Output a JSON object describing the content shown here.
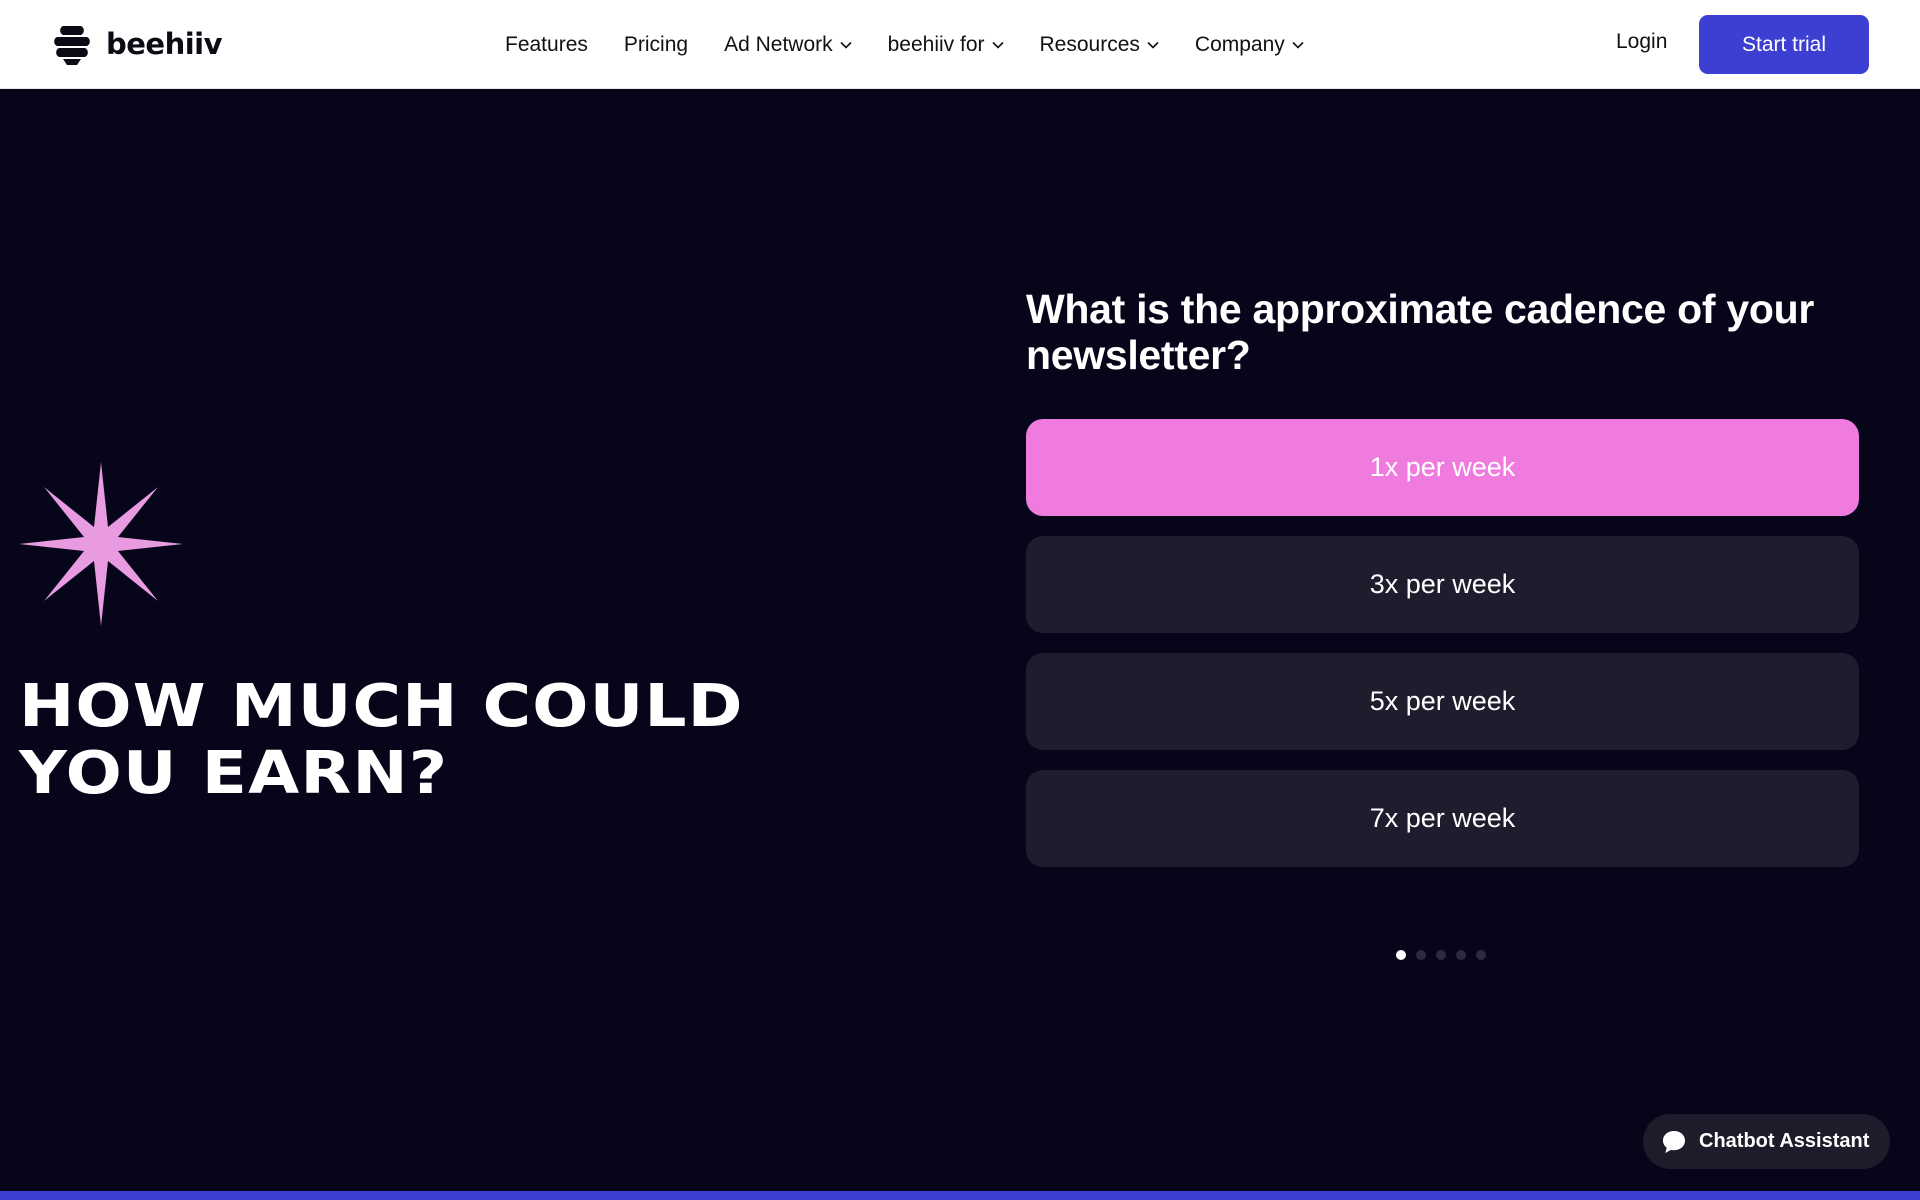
{
  "brand": {
    "name": "beehiiv"
  },
  "nav": {
    "items": [
      {
        "label": "Features",
        "has_dropdown": false
      },
      {
        "label": "Pricing",
        "has_dropdown": false
      },
      {
        "label": "Ad Network",
        "has_dropdown": true
      },
      {
        "label": "beehiiv for",
        "has_dropdown": true
      },
      {
        "label": "Resources",
        "has_dropdown": true
      },
      {
        "label": "Company",
        "has_dropdown": true
      }
    ],
    "login_label": "Login",
    "cta_label": "Start trial"
  },
  "hero": {
    "title_line1": "HOW MUCH COULD",
    "title_line2": "YOU EARN?",
    "decoration_icon": "sparkle-star-icon"
  },
  "quiz": {
    "question": "What is the approximate cadence of your newsletter?",
    "options": [
      {
        "label": "1x per week",
        "selected": true
      },
      {
        "label": "3x per week",
        "selected": false
      },
      {
        "label": "5x per week",
        "selected": false
      },
      {
        "label": "7x per week",
        "selected": false
      }
    ],
    "steps_total": 5,
    "current_step": 1
  },
  "chatbot": {
    "label": "Chatbot Assistant",
    "icon": "chat-bubble-icon"
  },
  "colors": {
    "background": "#06051a",
    "accent": "#3c3fd2",
    "selected_option": "#ef7bdf",
    "option": "#1e1d2e",
    "sparkle": "#e89be0"
  }
}
